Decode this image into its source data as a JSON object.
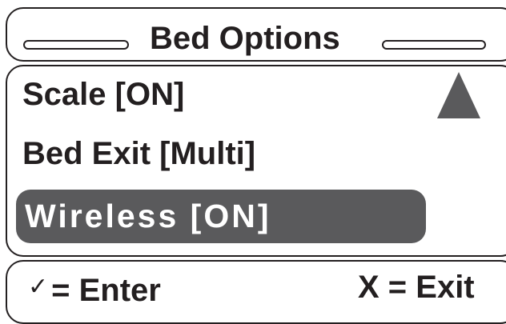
{
  "title": "Bed Options",
  "menu": {
    "items": [
      {
        "label": "Scale [ON]"
      },
      {
        "label": "Bed Exit [Multi]"
      },
      {
        "label": "Wireless [ON]",
        "selected": true
      }
    ],
    "scroll_icon": "triangle-up-icon"
  },
  "footer": {
    "enter_symbol": "✓",
    "enter_label": "= Enter",
    "exit_label": "X = Exit"
  },
  "colors": {
    "foreground": "#231f20",
    "highlight": "#5a5a5c",
    "background": "#ffffff"
  }
}
